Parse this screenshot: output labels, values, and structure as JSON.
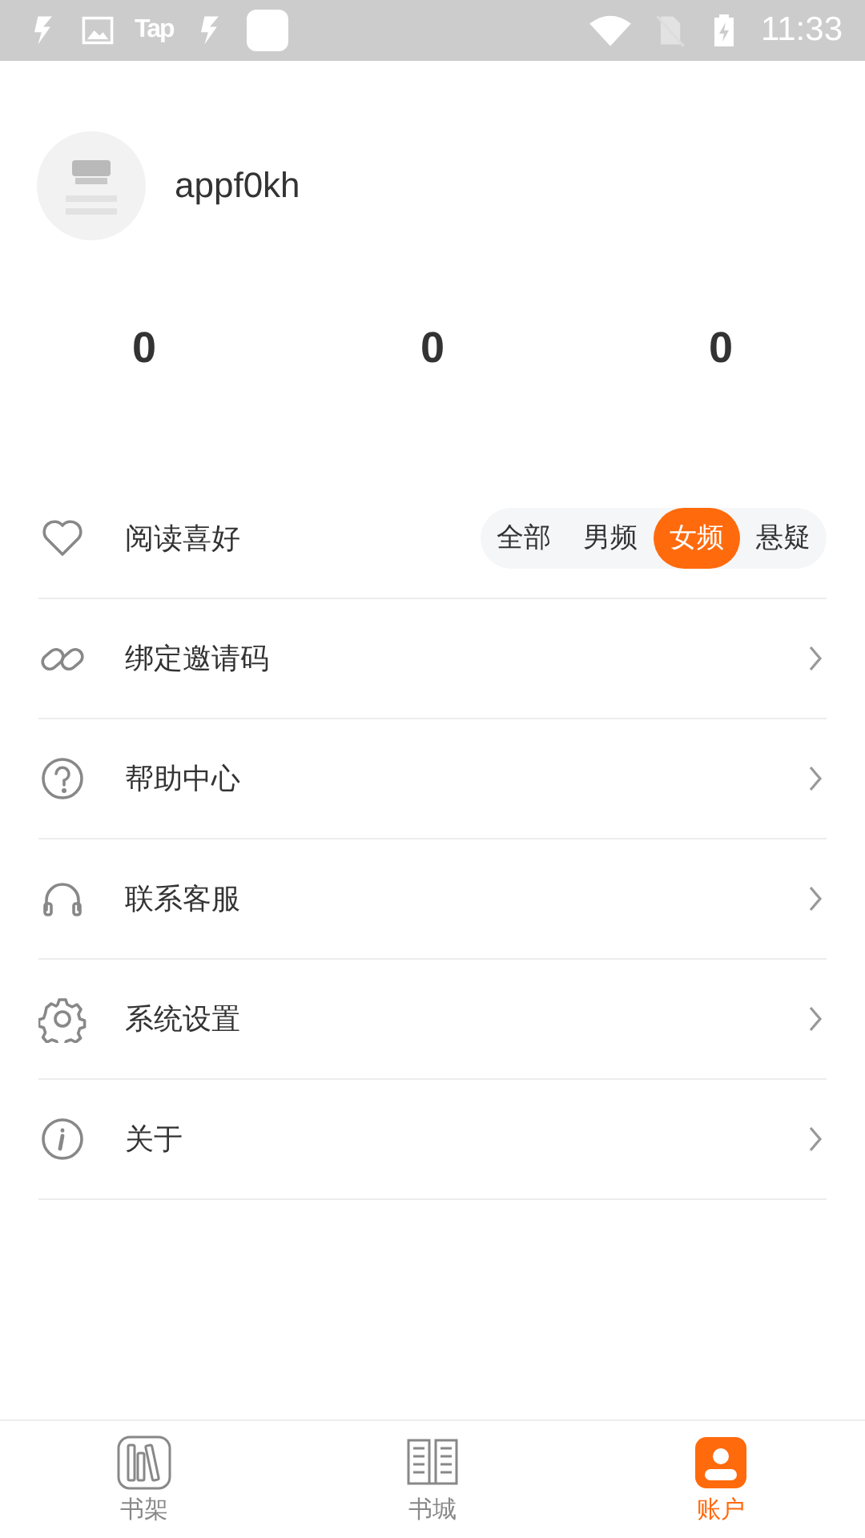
{
  "status_bar": {
    "app_label": "Tap",
    "time": "11:33"
  },
  "profile": {
    "username": "appf0kh"
  },
  "stats": [
    "0",
    "0",
    "0"
  ],
  "menu": [
    {
      "kind": "preference",
      "label": "阅读喜好",
      "options": [
        {
          "label": "全部",
          "selected": false
        },
        {
          "label": "男频",
          "selected": false
        },
        {
          "label": "女频",
          "selected": true
        },
        {
          "label": "悬疑",
          "selected": false
        }
      ]
    },
    {
      "kind": "link",
      "label": "绑定邀请码"
    },
    {
      "kind": "link",
      "label": "帮助中心"
    },
    {
      "kind": "link",
      "label": "联系客服"
    },
    {
      "kind": "link",
      "label": "系统设置"
    },
    {
      "kind": "link",
      "label": "关于"
    }
  ],
  "bottom_nav": [
    {
      "label": "书架",
      "selected": false
    },
    {
      "label": "书城",
      "selected": false
    },
    {
      "label": "账户",
      "selected": true
    }
  ]
}
